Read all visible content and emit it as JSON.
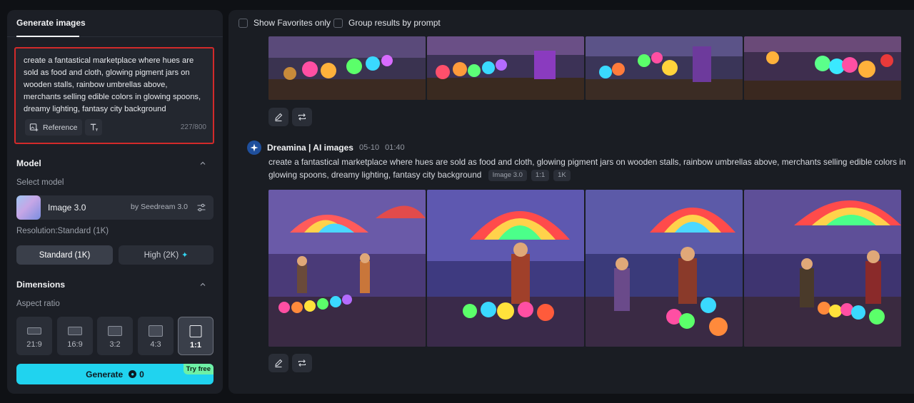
{
  "sidebar": {
    "tab_label": "Generate images",
    "prompt": {
      "text": "create a fantastical marketplace where hues are sold as food and cloth, glowing pigment jars on wooden stalls, rainbow umbrellas above, merchants selling edible colors in glowing spoons, dreamy lighting, fantasy city background",
      "char_count": "227/800",
      "reference_label": "Reference"
    },
    "model_section": {
      "title": "Model",
      "select_label": "Select model",
      "model_name": "Image 3.0",
      "model_by": "by Seedream 3.0"
    },
    "resolution": {
      "label": "Resolution:Standard (1K)",
      "options": [
        {
          "label": "Standard (1K)",
          "selected": true
        },
        {
          "label": "High (2K)",
          "selected": false
        }
      ]
    },
    "dimensions": {
      "title": "Dimensions",
      "aspect_label": "Aspect ratio",
      "ratios": [
        {
          "label": "21:9",
          "selected": false
        },
        {
          "label": "16:9",
          "selected": false
        },
        {
          "label": "3:2",
          "selected": false
        },
        {
          "label": "4:3",
          "selected": false
        },
        {
          "label": "1:1",
          "selected": true
        }
      ]
    },
    "generate": {
      "label": "Generate",
      "cost": "0",
      "badge": "Try free"
    }
  },
  "feed": {
    "filters": [
      {
        "label": "Show Favorites only",
        "checked": false
      },
      {
        "label": "Group results by prompt",
        "checked": false
      }
    ],
    "generation": {
      "source": "Dreamina | AI images",
      "date": "05-10",
      "time": "01:40",
      "prompt": "create a fantastical marketplace where hues are sold as food and cloth, glowing pigment jars on wooden stalls, rainbow umbrellas above, merchants selling edible colors in glowing spoons, dreamy lighting, fantasy city background",
      "tags": [
        "Image 3.0",
        "1:1",
        "1K"
      ]
    }
  },
  "colors": {
    "accent": "#20d3ef",
    "highlight_border": "#d22a2a",
    "try_free": "#6ef0a6"
  }
}
